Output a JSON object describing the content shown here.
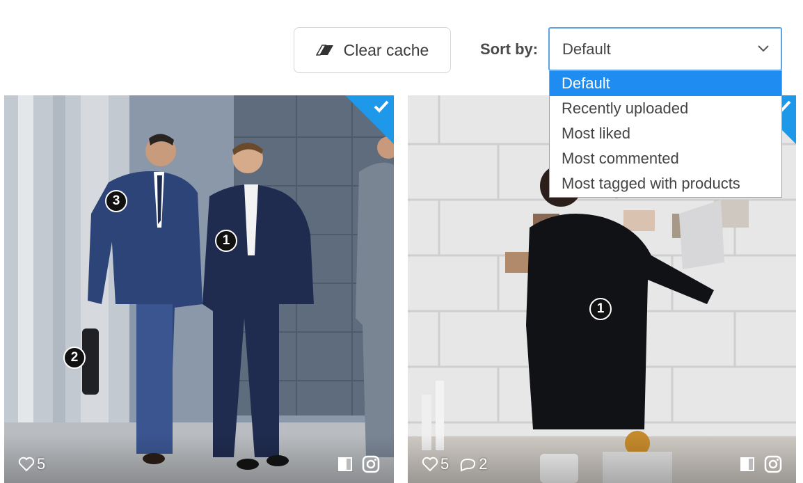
{
  "toolbar": {
    "clear_cache_label": "Clear cache",
    "sort_label": "Sort by:",
    "sort_value": "Default",
    "sort_options": [
      "Default",
      "Recently uploaded",
      "Most liked",
      "Most commented",
      "Most tagged with products"
    ]
  },
  "cards": [
    {
      "likes": "5",
      "tags": [
        "1",
        "2",
        "3"
      ],
      "selected": true
    },
    {
      "likes": "5",
      "comments": "2",
      "tags": [
        "1"
      ],
      "selected": true
    }
  ],
  "colors": {
    "accent": "#1e8cf0",
    "check_bg": "#1e98e8"
  },
  "icons": [
    "eraser-icon",
    "chevron-down-icon",
    "checkmark-icon",
    "heart-icon",
    "comment-icon",
    "product-icon",
    "instagram-icon"
  ]
}
